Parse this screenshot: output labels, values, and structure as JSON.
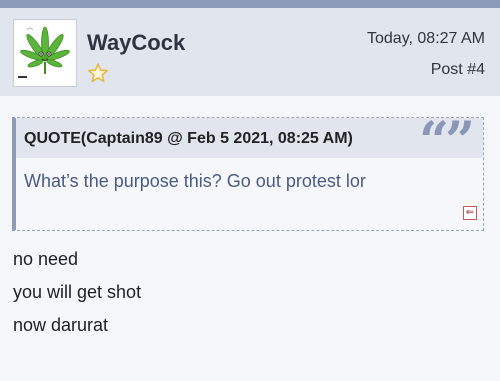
{
  "post": {
    "username": "WayCock",
    "date": "Today, 08:27 AM",
    "post_number": "Post #4",
    "avatar_icon": "cannabis-leaf-icon",
    "rank_icon": "star-outline-icon"
  },
  "quote": {
    "title": "QUOTE(Captain89 @ Feb 5 2021, 08:25 AM)",
    "text": "What’s the purpose this? Go out protest lor",
    "quote_marks": "“”",
    "back_icon": "back-arrow-icon"
  },
  "message": {
    "lines": [
      "no need",
      "you will get shot",
      "now darurat"
    ]
  },
  "colors": {
    "header_bg": "#e0e5ee",
    "quote_accent": "#8e9bb7",
    "quote_text": "#4a5a82",
    "star": "#e4b84a"
  }
}
